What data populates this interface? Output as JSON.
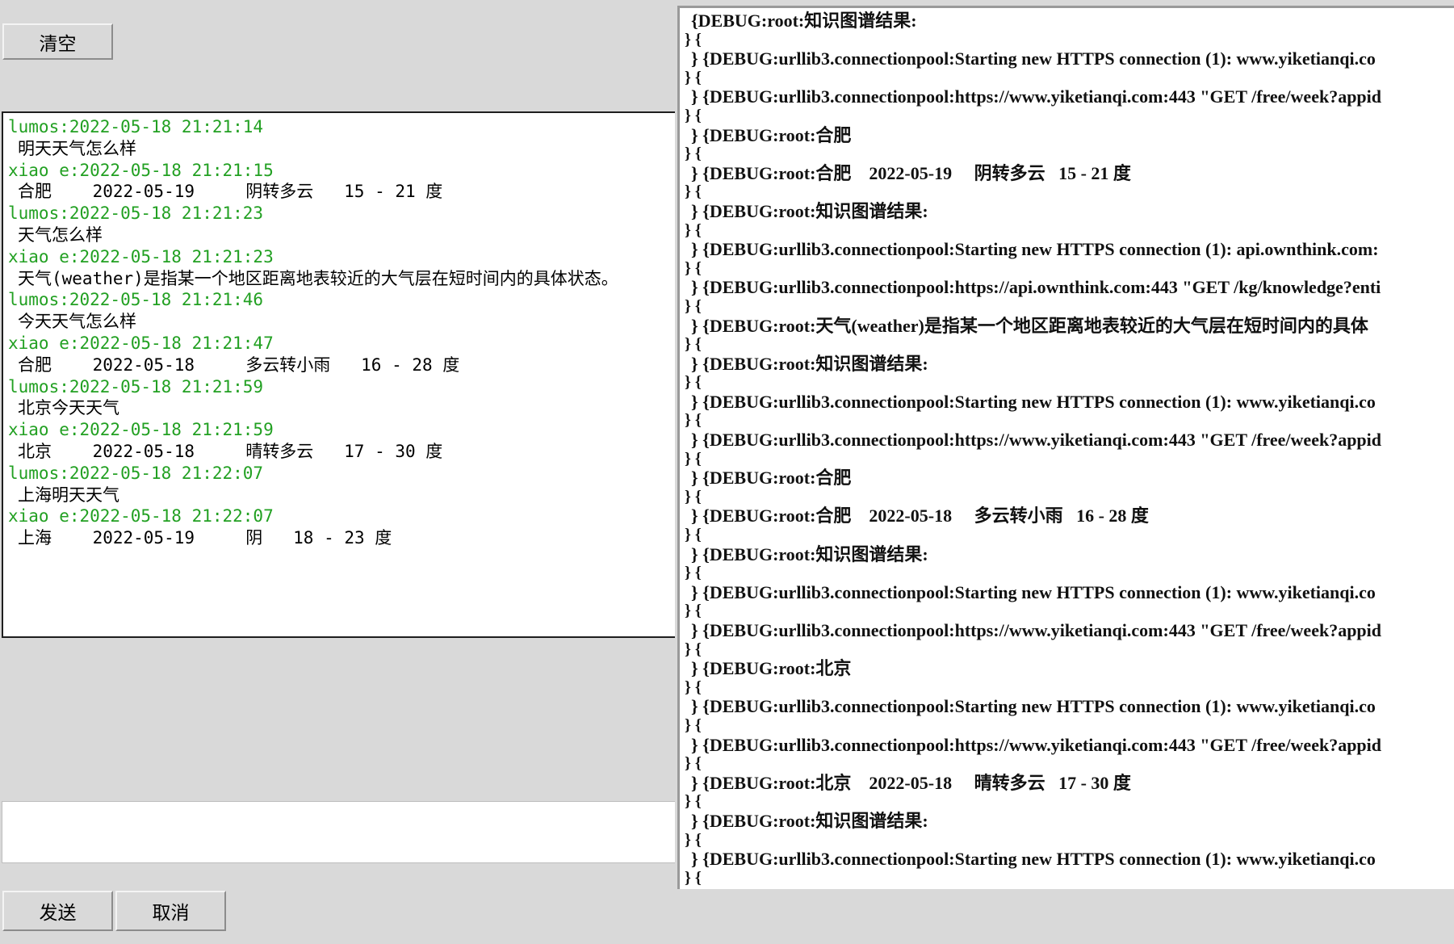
{
  "buttons": {
    "clear": "清空",
    "send": "发送",
    "cancel": "取消"
  },
  "input": {
    "value": ""
  },
  "chat": {
    "messages": [
      {
        "header": "lumos:2022-05-18 21:21:14",
        "body": "明天天气怎么样"
      },
      {
        "header": "xiao e:2022-05-18 21:21:15",
        "body": "合肥    2022-05-19     阴转多云   15 - 21 度"
      },
      {
        "header": "lumos:2022-05-18 21:21:23",
        "body": "天气怎么样"
      },
      {
        "header": "xiao e:2022-05-18 21:21:23",
        "body": "天气(weather)是指某一个地区距离地表较近的大气层在短时间内的具体状态。"
      },
      {
        "header": "lumos:2022-05-18 21:21:46",
        "body": "今天天气怎么样"
      },
      {
        "header": "xiao e:2022-05-18 21:21:47",
        "body": "合肥    2022-05-18     多云转小雨   16 - 28 度"
      },
      {
        "header": "lumos:2022-05-18 21:21:59",
        "body": "北京今天天气"
      },
      {
        "header": "xiao e:2022-05-18 21:21:59",
        "body": "北京    2022-05-18     晴转多云   17 - 30 度"
      },
      {
        "header": "lumos:2022-05-18 21:22:07",
        "body": "上海明天天气"
      },
      {
        "header": "xiao e:2022-05-18 21:22:07",
        "body": "上海    2022-05-19     阴   18 - 23 度"
      }
    ]
  },
  "log": {
    "separator": "} {",
    "lines": [
      "{DEBUG:root:知识图谱结果:",
      "} {DEBUG:urllib3.connectionpool:Starting new HTTPS connection (1): www.yiketianqi.co",
      "} {DEBUG:urllib3.connectionpool:https://www.yiketianqi.com:443 \"GET /free/week?appid",
      "} {DEBUG:root:合肥",
      "} {DEBUG:root:合肥    2022-05-19     阴转多云   15 - 21 度",
      "} {DEBUG:root:知识图谱结果:",
      "} {DEBUG:urllib3.connectionpool:Starting new HTTPS connection (1): api.ownthink.com:",
      "} {DEBUG:urllib3.connectionpool:https://api.ownthink.com:443 \"GET /kg/knowledge?enti",
      "} {DEBUG:root:天气(weather)是指某一个地区距离地表较近的大气层在短时间内的具体",
      "} {DEBUG:root:知识图谱结果:",
      "} {DEBUG:urllib3.connectionpool:Starting new HTTPS connection (1): www.yiketianqi.co",
      "} {DEBUG:urllib3.connectionpool:https://www.yiketianqi.com:443 \"GET /free/week?appid",
      "} {DEBUG:root:合肥",
      "} {DEBUG:root:合肥    2022-05-18     多云转小雨   16 - 28 度",
      "} {DEBUG:root:知识图谱结果:",
      "} {DEBUG:urllib3.connectionpool:Starting new HTTPS connection (1): www.yiketianqi.co",
      "} {DEBUG:urllib3.connectionpool:https://www.yiketianqi.com:443 \"GET /free/week?appid",
      "} {DEBUG:root:北京",
      "} {DEBUG:urllib3.connectionpool:Starting new HTTPS connection (1): www.yiketianqi.co",
      "} {DEBUG:urllib3.connectionpool:https://www.yiketianqi.com:443 \"GET /free/week?appid",
      "} {DEBUG:root:北京    2022-05-18     晴转多云   17 - 30 度",
      "} {DEBUG:root:知识图谱结果:",
      "} {DEBUG:urllib3.connectionpool:Starting new HTTPS connection (1): www.yiketianqi.co"
    ]
  }
}
